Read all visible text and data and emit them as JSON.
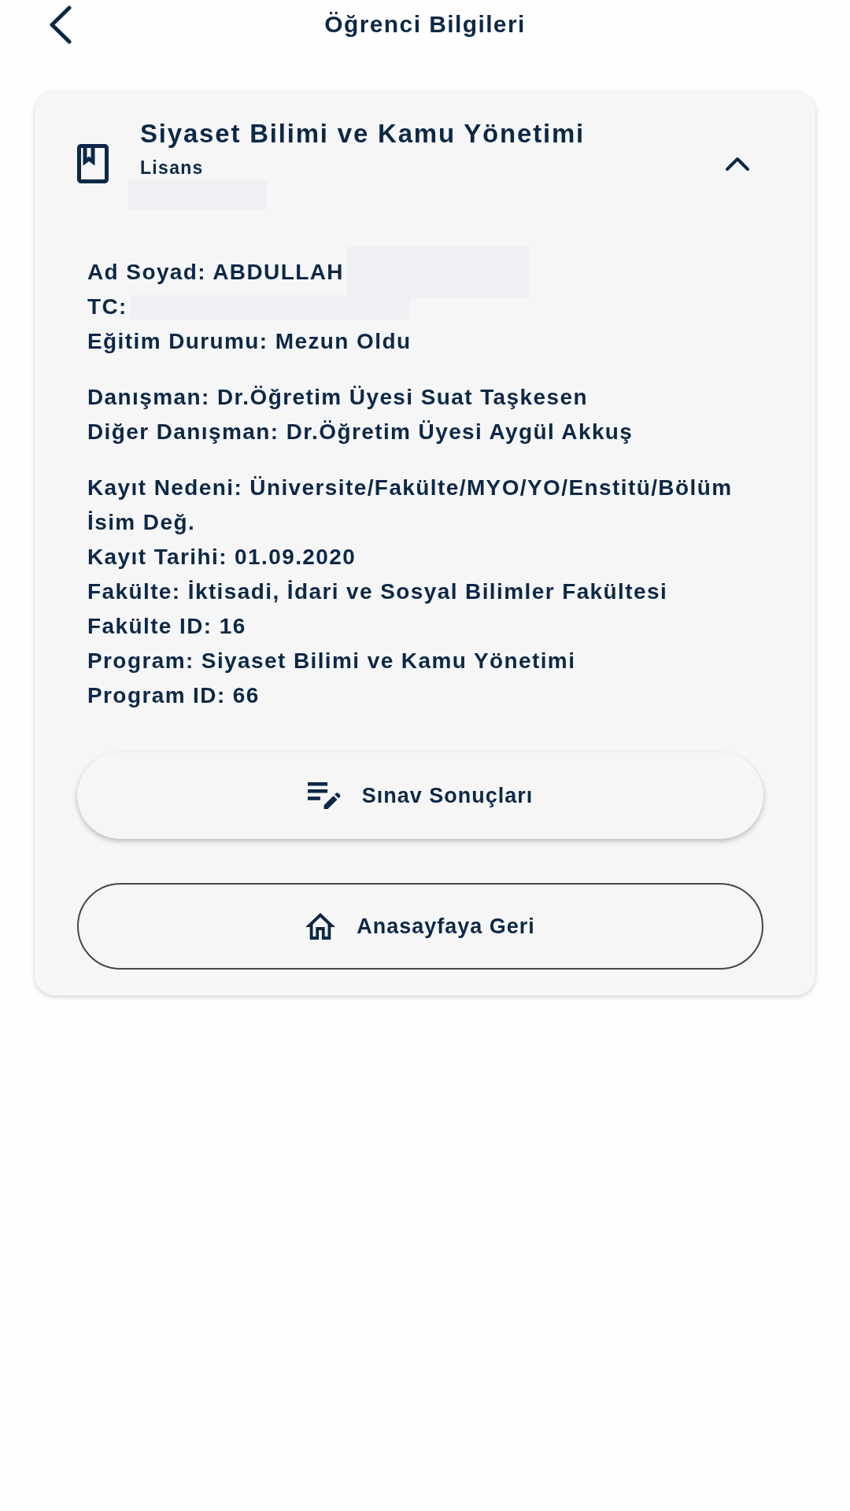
{
  "top_bar": {
    "title": "Öğrenci Bilgileri"
  },
  "program_card": {
    "title": "Siyaset Bilimi ve Kamu Yönetimi",
    "degree": "Lisans",
    "redacted_line": true,
    "expanded": true,
    "info_groups": [
      {
        "lines": [
          {
            "text": "Ad Soyad: ABDULLAH",
            "redacted": true
          },
          {
            "text": "TC:",
            "redacted": true
          },
          {
            "text": "Eğitim Durumu: Mezun Oldu",
            "redacted": false
          }
        ]
      },
      {
        "lines": [
          {
            "text": "Danışman: Dr.Öğretim Üyesi Suat Taşkesen",
            "redacted": false
          },
          {
            "text": "Diğer Danışman: Dr.Öğretim Üyesi Aygül Akkuş",
            "redacted": false
          }
        ]
      },
      {
        "lines": [
          {
            "text": "Kayıt Nedeni: Üniversite/Fakülte/MYO/YO/Enstitü/Bölüm İsim Değ.",
            "redacted": false
          },
          {
            "text": "Kayıt Tarihi: 01.09.2020",
            "redacted": false
          },
          {
            "text": "Fakülte: İktisadi, İdari ve Sosyal Bilimler Fakültesi",
            "redacted": false
          },
          {
            "text": "Fakülte ID: 16",
            "redacted": false
          },
          {
            "text": "Program: Siyaset Bilimi ve Kamu Yönetimi",
            "redacted": false
          },
          {
            "text": "Program ID: 66",
            "redacted": false
          }
        ]
      }
    ],
    "buttons": [
      {
        "label": "Sınav Sonuçları",
        "kind": "raised"
      },
      {
        "label": "Anasayfaya Geri",
        "kind": "outlined"
      }
    ]
  }
}
